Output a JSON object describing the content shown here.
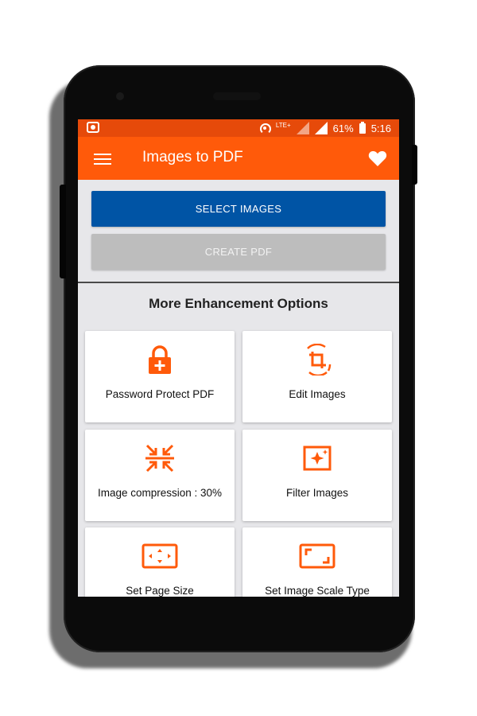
{
  "status_bar": {
    "network_label": "LTE+",
    "battery": "61%",
    "time": "5:16"
  },
  "app_bar": {
    "title": "Images to PDF"
  },
  "actions": {
    "select_images": "SELECT IMAGES",
    "create_pdf": "CREATE PDF"
  },
  "section": {
    "title": "More Enhancement Options"
  },
  "options": [
    {
      "label": "Password Protect PDF",
      "icon": "lock-plus-icon"
    },
    {
      "label": "Edit Images",
      "icon": "crop-rotate-icon"
    },
    {
      "label": "Image compression : 30%",
      "icon": "compress-arrows-icon"
    },
    {
      "label": "Filter Images",
      "icon": "image-filter-icon"
    },
    {
      "label": "Set Page Size",
      "icon": "page-size-icon"
    },
    {
      "label": "Set Image Scale Type",
      "icon": "scale-type-icon"
    }
  ],
  "colors": {
    "status_bar": "#e64a0a",
    "app_bar": "#ff5a0a",
    "primary_button": "#0054a5",
    "disabled_button": "#bdbdbd",
    "icon_accent": "#ff5a0a"
  }
}
